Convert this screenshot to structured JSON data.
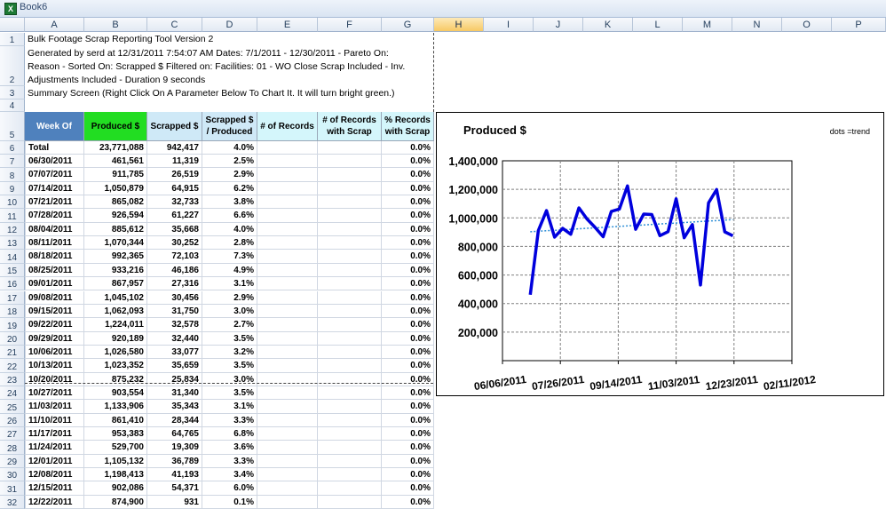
{
  "window": {
    "title": "Book6",
    "app_icon": "excel-icon"
  },
  "columns": [
    "A",
    "B",
    "C",
    "D",
    "E",
    "F",
    "G",
    "H",
    "I",
    "J",
    "K",
    "L",
    "M",
    "N",
    "O",
    "P"
  ],
  "selected_column": "H",
  "info": {
    "line1": "Bulk Footage Scrap Reporting Tool Version 2",
    "line2a": "Generated by serd at 12/31/2011 7:54:07 AM  Dates: 7/1/2011 - 12/30/2011 - Pareto On:",
    "line2b": "Reason - Sorted On: Scrapped $  Filtered on:   Facilities: 01   - WO Close Scrap Included - Inv.",
    "line2c": "Adjustments Included - Duration 9 seconds",
    "line3": "Summary Screen (Right Click On A Parameter Below To Chart It.  It will turn bright green.)"
  },
  "table": {
    "headers": [
      "Week Of",
      "Produced $",
      "Scrapped $",
      "Scrapped $ / Produced",
      "# of Records",
      "# of Records with Scrap",
      "% Records with Scrap"
    ],
    "total": {
      "week": "Total",
      "produced": "23,771,088",
      "scrapped": "942,417",
      "ratio": "4.0%",
      "records": "",
      "records_scrap": "",
      "pct": "0.0%"
    },
    "rows": [
      {
        "week": "06/30/2011",
        "produced": "461,561",
        "scrapped": "11,319",
        "ratio": "2.5%",
        "pct": "0.0%"
      },
      {
        "week": "07/07/2011",
        "produced": "911,785",
        "scrapped": "26,519",
        "ratio": "2.9%",
        "pct": "0.0%"
      },
      {
        "week": "07/14/2011",
        "produced": "1,050,879",
        "scrapped": "64,915",
        "ratio": "6.2%",
        "pct": "0.0%"
      },
      {
        "week": "07/21/2011",
        "produced": "865,082",
        "scrapped": "32,733",
        "ratio": "3.8%",
        "pct": "0.0%"
      },
      {
        "week": "07/28/2011",
        "produced": "926,594",
        "scrapped": "61,227",
        "ratio": "6.6%",
        "pct": "0.0%"
      },
      {
        "week": "08/04/2011",
        "produced": "885,612",
        "scrapped": "35,668",
        "ratio": "4.0%",
        "pct": "0.0%"
      },
      {
        "week": "08/11/2011",
        "produced": "1,070,344",
        "scrapped": "30,252",
        "ratio": "2.8%",
        "pct": "0.0%"
      },
      {
        "week": "08/18/2011",
        "produced": "992,365",
        "scrapped": "72,103",
        "ratio": "7.3%",
        "pct": "0.0%"
      },
      {
        "week": "08/25/2011",
        "produced": "933,216",
        "scrapped": "46,186",
        "ratio": "4.9%",
        "pct": "0.0%"
      },
      {
        "week": "09/01/2011",
        "produced": "867,957",
        "scrapped": "27,316",
        "ratio": "3.1%",
        "pct": "0.0%"
      },
      {
        "week": "09/08/2011",
        "produced": "1,045,102",
        "scrapped": "30,456",
        "ratio": "2.9%",
        "pct": "0.0%"
      },
      {
        "week": "09/15/2011",
        "produced": "1,062,093",
        "scrapped": "31,750",
        "ratio": "3.0%",
        "pct": "0.0%"
      },
      {
        "week": "09/22/2011",
        "produced": "1,224,011",
        "scrapped": "32,578",
        "ratio": "2.7%",
        "pct": "0.0%"
      },
      {
        "week": "09/29/2011",
        "produced": "920,189",
        "scrapped": "32,440",
        "ratio": "3.5%",
        "pct": "0.0%"
      },
      {
        "week": "10/06/2011",
        "produced": "1,026,580",
        "scrapped": "33,077",
        "ratio": "3.2%",
        "pct": "0.0%"
      },
      {
        "week": "10/13/2011",
        "produced": "1,023,352",
        "scrapped": "35,659",
        "ratio": "3.5%",
        "pct": "0.0%"
      },
      {
        "week": "10/20/2011",
        "produced": "875,232",
        "scrapped": "25,834",
        "ratio": "3.0%",
        "pct": "0.0%"
      },
      {
        "week": "10/27/2011",
        "produced": "903,554",
        "scrapped": "31,340",
        "ratio": "3.5%",
        "pct": "0.0%"
      },
      {
        "week": "11/03/2011",
        "produced": "1,133,906",
        "scrapped": "35,343",
        "ratio": "3.1%",
        "pct": "0.0%"
      },
      {
        "week": "11/10/2011",
        "produced": "861,410",
        "scrapped": "28,344",
        "ratio": "3.3%",
        "pct": "0.0%"
      },
      {
        "week": "11/17/2011",
        "produced": "953,383",
        "scrapped": "64,765",
        "ratio": "6.8%",
        "pct": "0.0%"
      },
      {
        "week": "11/24/2011",
        "produced": "529,700",
        "scrapped": "19,309",
        "ratio": "3.6%",
        "pct": "0.0%"
      },
      {
        "week": "12/01/2011",
        "produced": "1,105,132",
        "scrapped": "36,789",
        "ratio": "3.3%",
        "pct": "0.0%"
      },
      {
        "week": "12/08/2011",
        "produced": "1,198,413",
        "scrapped": "41,193",
        "ratio": "3.4%",
        "pct": "0.0%"
      },
      {
        "week": "12/15/2011",
        "produced": "902,086",
        "scrapped": "54,371",
        "ratio": "6.0%",
        "pct": "0.0%"
      },
      {
        "week": "12/22/2011",
        "produced": "874,900",
        "scrapped": "931",
        "ratio": "0.1%",
        "pct": "0.0%"
      }
    ]
  },
  "chart_data": {
    "type": "line",
    "title": "Produced $",
    "legend_text": "dots =trend",
    "x_tick_labels": [
      "06/06/2011",
      "07/26/2011",
      "09/14/2011",
      "11/03/2011",
      "12/23/2011",
      "02/11/2012"
    ],
    "x_range": [
      "2011-06-06",
      "2012-02-11"
    ],
    "y_tick_labels": [
      "1,400,000",
      "1,200,000",
      "1,000,000",
      "800,000",
      "600,000",
      "400,000",
      "200,000"
    ],
    "ylim": [
      0,
      1400000
    ],
    "grid": true,
    "series": [
      {
        "color": "#0000dd",
        "x": [
          "2011-06-30",
          "2011-07-07",
          "2011-07-14",
          "2011-07-21",
          "2011-07-28",
          "2011-08-04",
          "2011-08-11",
          "2011-08-18",
          "2011-08-25",
          "2011-09-01",
          "2011-09-08",
          "2011-09-15",
          "2011-09-22",
          "2011-09-29",
          "2011-10-06",
          "2011-10-13",
          "2011-10-20",
          "2011-10-27",
          "2011-11-03",
          "2011-11-10",
          "2011-11-17",
          "2011-11-24",
          "2011-12-01",
          "2011-12-08",
          "2011-12-15",
          "2011-12-22"
        ],
        "values": [
          461561,
          911785,
          1050879,
          865082,
          926594,
          885612,
          1070344,
          992365,
          933216,
          867957,
          1045102,
          1062093,
          1224011,
          920189,
          1026580,
          1023352,
          875232,
          903554,
          1133906,
          861410,
          953383,
          529700,
          1105132,
          1198413,
          902086,
          874900
        ]
      }
    ],
    "trend": {
      "color": "#2e8fd6",
      "start": [
        "2011-06-30",
        903000
      ],
      "end": [
        "2011-12-22",
        988000
      ]
    }
  }
}
